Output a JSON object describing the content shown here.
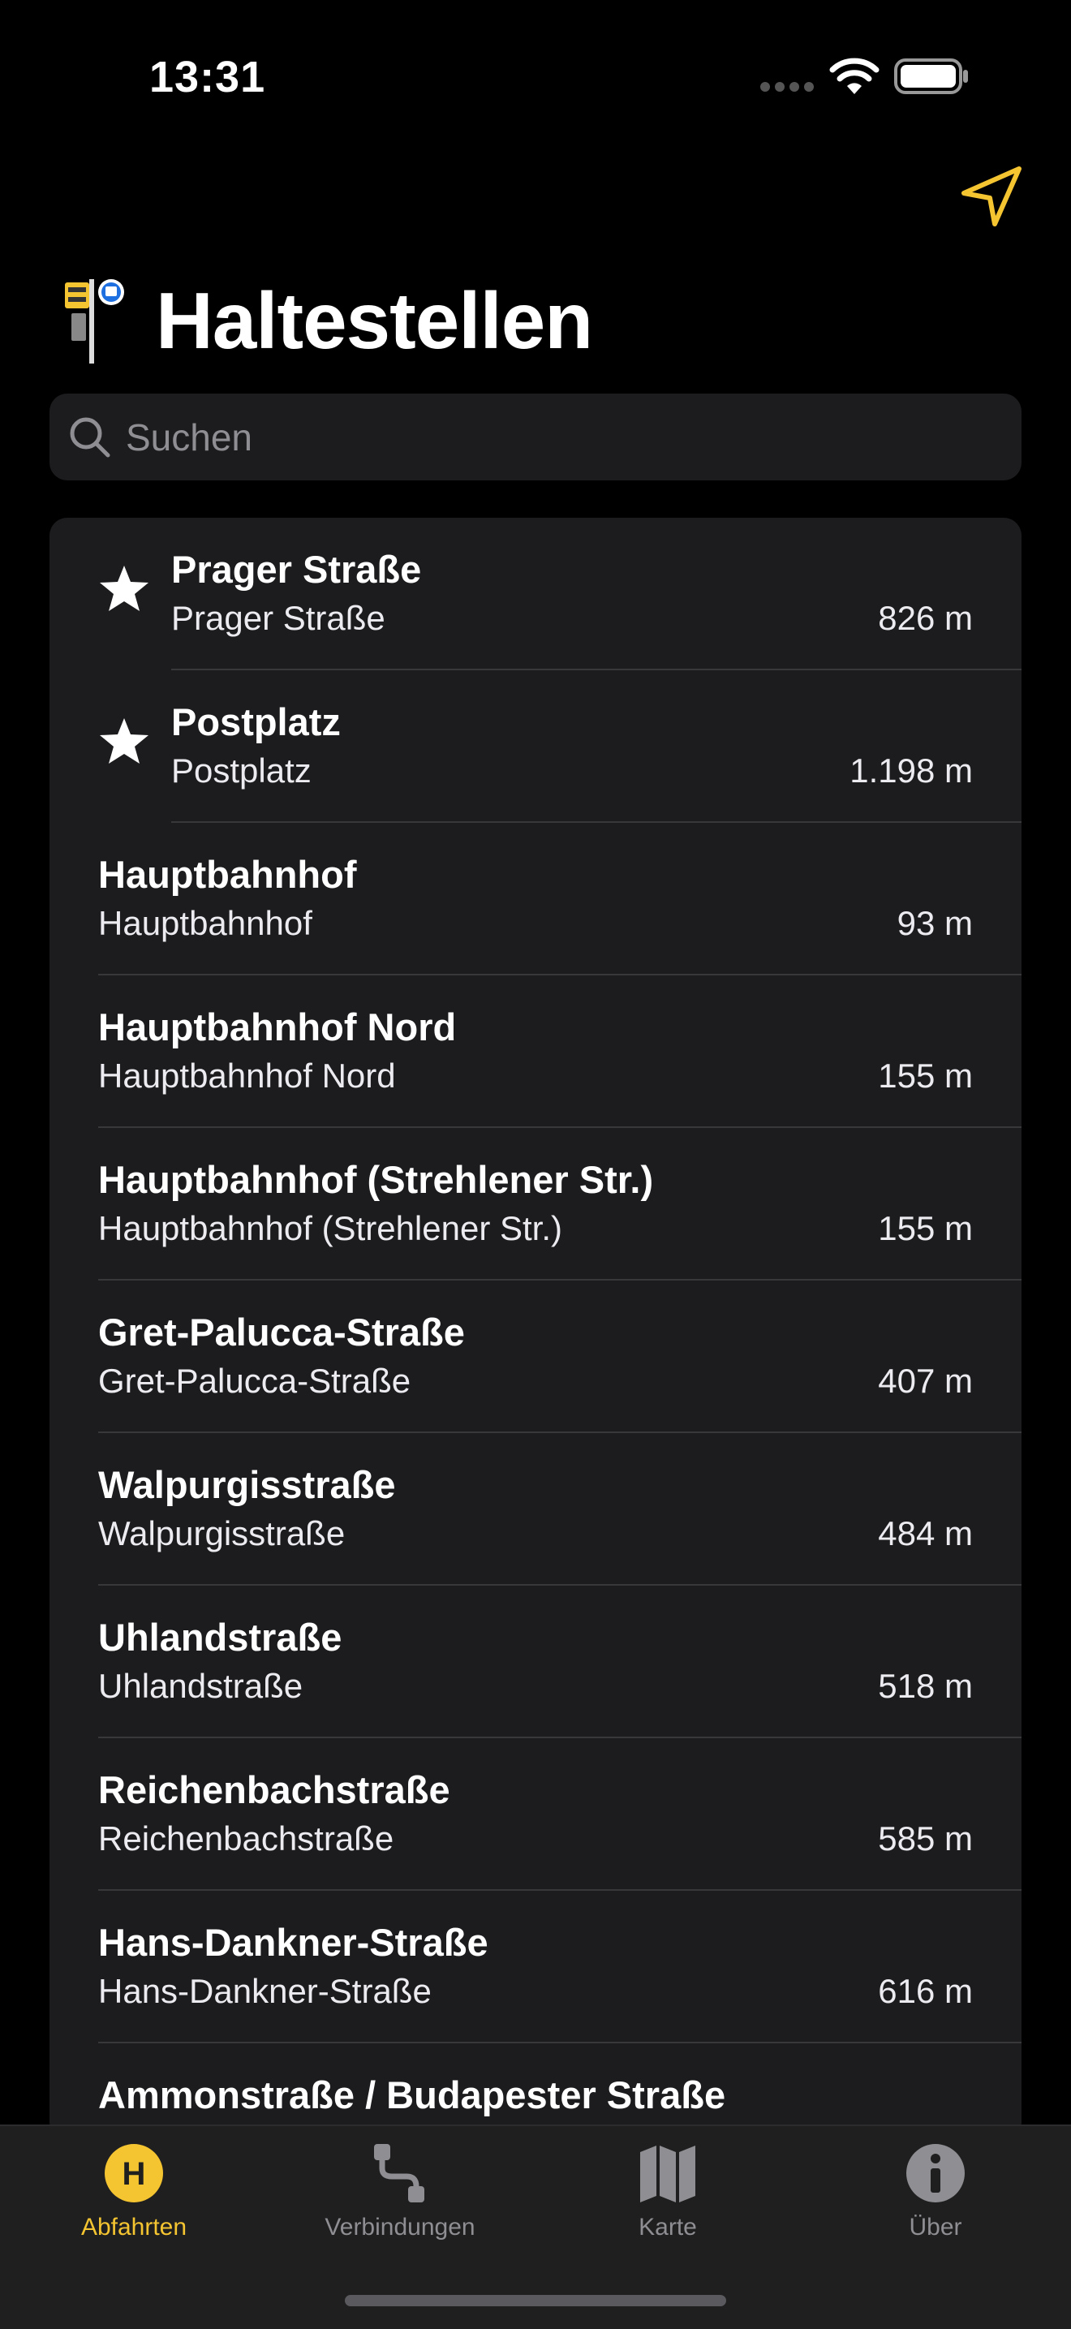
{
  "status": {
    "time": "13:31"
  },
  "nav": {
    "title": "Haltestellen"
  },
  "search": {
    "placeholder": "Suchen"
  },
  "stops": [
    {
      "name": "Prager Straße",
      "sub": "Prager Straße",
      "distance": "826 m",
      "favorite": true
    },
    {
      "name": "Postplatz",
      "sub": "Postplatz",
      "distance": "1.198 m",
      "favorite": true
    },
    {
      "name": "Hauptbahnhof",
      "sub": "Hauptbahnhof",
      "distance": "93 m",
      "favorite": false
    },
    {
      "name": "Hauptbahnhof Nord",
      "sub": "Hauptbahnhof Nord",
      "distance": "155 m",
      "favorite": false
    },
    {
      "name": "Hauptbahnhof (Strehlener Str.)",
      "sub": "Hauptbahnhof (Strehlener Str.)",
      "distance": "155 m",
      "favorite": false
    },
    {
      "name": "Gret-Palucca-Straße",
      "sub": "Gret-Palucca-Straße",
      "distance": "407 m",
      "favorite": false
    },
    {
      "name": "Walpurgisstraße",
      "sub": "Walpurgisstraße",
      "distance": "484 m",
      "favorite": false
    },
    {
      "name": "Uhlandstraße",
      "sub": "Uhlandstraße",
      "distance": "518 m",
      "favorite": false
    },
    {
      "name": "Reichenbachstraße",
      "sub": "Reichenbachstraße",
      "distance": "585 m",
      "favorite": false
    },
    {
      "name": "Hans-Dankner-Straße",
      "sub": "Hans-Dankner-Straße",
      "distance": "616 m",
      "favorite": false
    },
    {
      "name": "Ammonstraße / Budapester Straße",
      "sub": "",
      "distance": "",
      "favorite": false
    }
  ],
  "tabs": [
    {
      "label": "Abfahrten",
      "icon": "departures-icon",
      "active": true
    },
    {
      "label": "Verbindungen",
      "icon": "route-icon",
      "active": false
    },
    {
      "label": "Karte",
      "icon": "map-icon",
      "active": false
    },
    {
      "label": "Über",
      "icon": "info-icon",
      "active": false
    }
  ],
  "colors": {
    "accent": "#f4c431",
    "background": "#000000",
    "card": "#1c1c1e"
  }
}
